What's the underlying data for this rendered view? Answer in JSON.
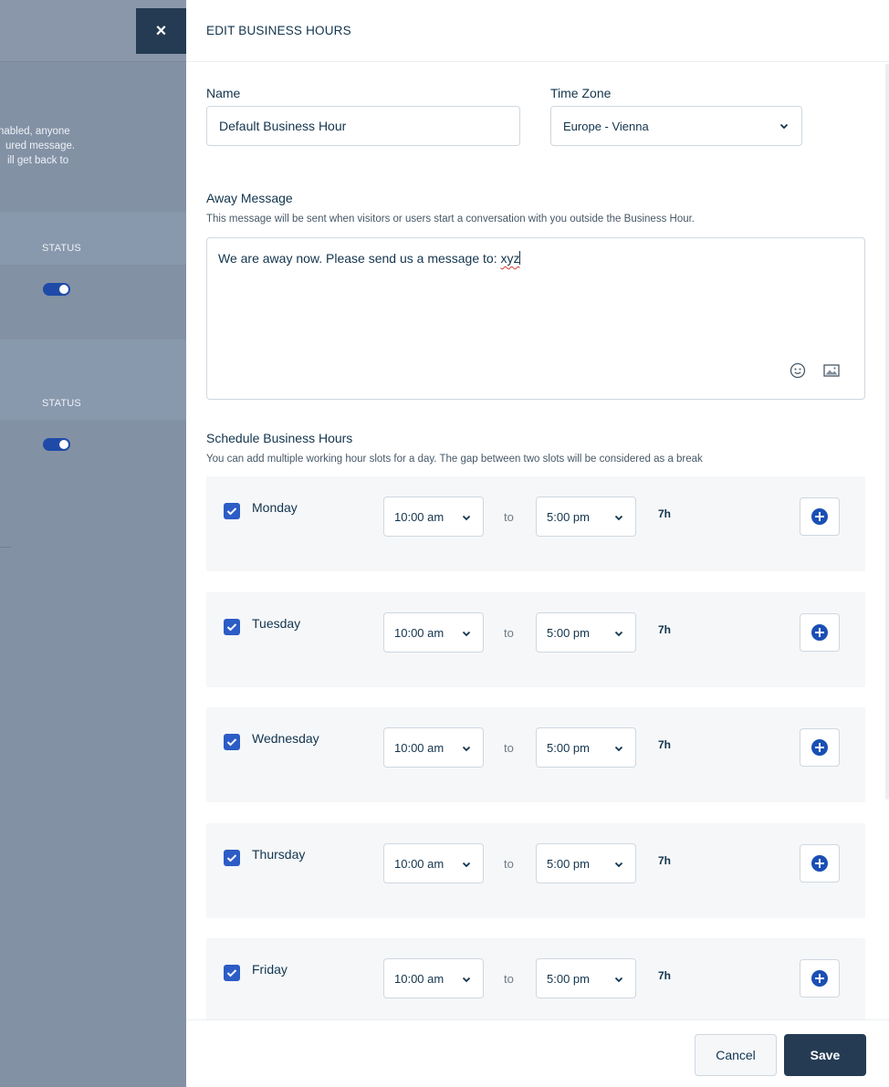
{
  "background": {
    "description_lines": [
      "nabled, anyone",
      "ured message.",
      "ill get back to"
    ],
    "sections": [
      {
        "status_label": "STATUS",
        "toggle_on": true
      },
      {
        "status_label": "STATUS",
        "toggle_on": true
      }
    ]
  },
  "close_icon": "×",
  "panel": {
    "title": "EDIT BUSINESS HOURS",
    "name": {
      "label": "Name",
      "value": "Default Business Hour"
    },
    "timezone": {
      "label": "Time Zone",
      "value": "Europe - Vienna"
    },
    "away_message": {
      "label": "Away Message",
      "hint": "This message will be sent when visitors or users start a conversation with you outside the Business Hour.",
      "text_prefix": "We are away now. Please send us a message to: ",
      "text_misspelled": "xyz"
    },
    "schedule": {
      "label": "Schedule Business Hours",
      "hint": "You can add multiple working hour slots for a day. The gap between two slots will be considered as a break",
      "to_label": "to",
      "days": [
        {
          "name": "Monday",
          "checked": true,
          "from": "10:00 am",
          "to": "5:00 pm",
          "duration": "7h"
        },
        {
          "name": "Tuesday",
          "checked": true,
          "from": "10:00 am",
          "to": "5:00 pm",
          "duration": "7h"
        },
        {
          "name": "Wednesday",
          "checked": true,
          "from": "10:00 am",
          "to": "5:00 pm",
          "duration": "7h"
        },
        {
          "name": "Thursday",
          "checked": true,
          "from": "10:00 am",
          "to": "5:00 pm",
          "duration": "7h"
        },
        {
          "name": "Friday",
          "checked": true,
          "from": "10:00 am",
          "to": "5:00 pm",
          "duration": "7h"
        }
      ]
    },
    "footer": {
      "cancel_label": "Cancel",
      "save_label": "Save"
    }
  },
  "colors": {
    "primary": "#2c5cc5",
    "save_button": "#243b53",
    "text": "#12344d",
    "overlay": "#8391a5"
  }
}
